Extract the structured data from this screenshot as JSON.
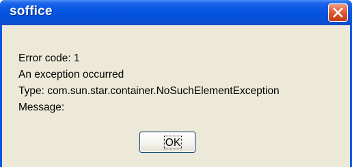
{
  "window": {
    "title": "soffice"
  },
  "message": {
    "line1": "Error code: 1",
    "line2": "An exception occurred",
    "line3": "Type: com.sun.star.container.NoSuchElementException",
    "line4": "Message:"
  },
  "buttons": {
    "ok_label": "OK"
  },
  "colors": {
    "titlebar": "#0a58e4",
    "close_button": "#d2491f",
    "dialog_background": "#ece9d8"
  },
  "icons": {
    "close": "close-icon"
  }
}
